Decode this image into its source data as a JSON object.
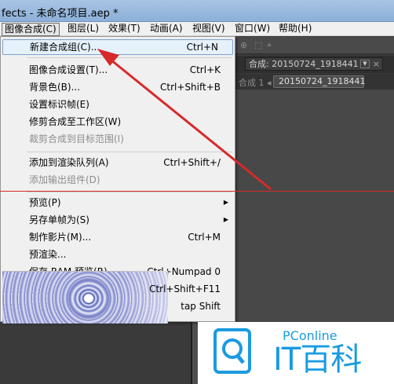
{
  "window": {
    "title": "fects - 未命名项目.aep *"
  },
  "menubar": {
    "items": [
      {
        "label": "图像合成(C)"
      },
      {
        "label": "图层(L)"
      },
      {
        "label": "效果(T)"
      },
      {
        "label": "动画(A)"
      },
      {
        "label": "视图(V)"
      },
      {
        "label": "窗口(W)"
      },
      {
        "label": "帮助(H)"
      }
    ]
  },
  "dropdown": {
    "items": [
      {
        "label": "新建合成组(C)...",
        "shortcut": "Ctrl+N",
        "state": "highlighted"
      },
      {
        "label": "图像合成设置(T)...",
        "shortcut": "Ctrl+K"
      },
      {
        "label": "背景色(B)...",
        "shortcut": "Ctrl+Shift+B"
      },
      {
        "label": "设置标识帧(E)",
        "shortcut": ""
      },
      {
        "label": "修剪合成至工作区(W)",
        "shortcut": ""
      },
      {
        "label": "裁剪合成到目标范围(I)",
        "shortcut": "",
        "state": "disabled"
      },
      {
        "label": "添加到渲染队列(A)",
        "shortcut": "Ctrl+Shift+/"
      },
      {
        "label": "添加输出组件(D)",
        "shortcut": "",
        "state": "disabled"
      },
      {
        "label": "预览(P)",
        "shortcut": "",
        "submenu": true
      },
      {
        "label": "另存单帧为(S)",
        "shortcut": "",
        "submenu": true
      },
      {
        "label": "制作影片(M)...",
        "shortcut": "Ctrl+M"
      },
      {
        "label": "预渲染...",
        "shortcut": ""
      },
      {
        "label": "保存 RAM 预览(R)...",
        "shortcut": "Ctrl+Numpad 0"
      },
      {
        "label": "",
        "shortcut": "Ctrl+Shift+F11"
      },
      {
        "label": "",
        "shortcut": "tap Shift"
      }
    ]
  },
  "composition": {
    "tab_label": "合成: 20150724_1918441",
    "breadcrumb_label": "合成 1",
    "breadcrumb_item": "20150724_1918441"
  },
  "watermark": {
    "brand_small": "PConline",
    "brand_large": "IT百科",
    "color": "#1a9be0"
  },
  "annotation": {
    "color": "#d62a2a"
  }
}
